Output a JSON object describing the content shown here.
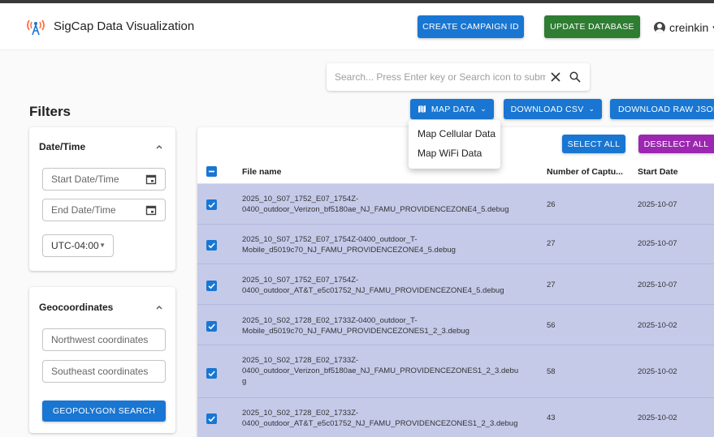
{
  "app": {
    "title": "SigCap Data Visualization",
    "user": "creinkin",
    "create_campaign_label": "CREATE CAMPAIGN ID",
    "update_database_label": "UPDATE DATABASE"
  },
  "search": {
    "placeholder": "Search... Press Enter key or Search icon to submit search"
  },
  "filters": {
    "title": "Filters",
    "datetime": {
      "title": "Date/Time",
      "start_placeholder": "Start Date/Time",
      "end_placeholder": "End Date/Time",
      "timezone": "UTC-04:00"
    },
    "geo": {
      "title": "Geocoordinates",
      "northwest_placeholder": "Northwest coordinates",
      "southeast_placeholder": "Southeast coordinates",
      "search_label": "GEOPOLYGON SEARCH"
    }
  },
  "toolbar": {
    "map_data_label": "MAP DATA",
    "download_csv_label": "DOWNLOAD CSV",
    "download_json_label": "DOWNLOAD RAW JSON",
    "select_all_label": "SELECT ALL",
    "deselect_all_label": "DESELECT ALL"
  },
  "map_menu": {
    "items": [
      "Map Cellular Data",
      "Map WiFi Data"
    ]
  },
  "table": {
    "headers": {
      "file_name": "File name",
      "captures": "Number of Captu...",
      "start_date": "Start Date"
    },
    "rows": [
      {
        "file": "2025_10_S07_1752_E07_1754Z-0400_outdoor_Verizon_bf5180ae_NJ_FAMU_PROVIDENCEZONE4_5.debug",
        "line1": "2025_10_S07_1752_E07_1754Z-",
        "line2": "0400_outdoor_Verizon_bf5180ae_NJ_FAMU_PROVIDENCEZONE4_5.debug",
        "line3": "",
        "count": "26",
        "date": "2025-10-07"
      },
      {
        "file": "2025_10_S07_1752_E07_1754Z-0400_outdoor_T-Mobile_d5019c70_NJ_FAMU_PROVIDENCEZONE4_5.debug",
        "line1": "2025_10_S07_1752_E07_1754Z-0400_outdoor_T-",
        "line2": "Mobile_d5019c70_NJ_FAMU_PROVIDENCEZONE4_5.debug",
        "line3": "",
        "count": "27",
        "date": "2025-10-07"
      },
      {
        "file": "2025_10_S07_1752_E07_1754Z-0400_outdoor_AT&T_e5c01752_NJ_FAMU_PROVIDENCEZONE4_5.debug",
        "line1": "2025_10_S07_1752_E07_1754Z-",
        "line2": "0400_outdoor_AT&T_e5c01752_NJ_FAMU_PROVIDENCEZONE4_5.debug",
        "line3": "",
        "count": "27",
        "date": "2025-10-07"
      },
      {
        "file": "2025_10_S02_1728_E02_1733Z-0400_outdoor_T-Mobile_d5019c70_NJ_FAMU_PROVIDENCEZONES1_2_3.debug",
        "line1": "2025_10_S02_1728_E02_1733Z-0400_outdoor_T-",
        "line2": "Mobile_d5019c70_NJ_FAMU_PROVIDENCEZONES1_2_3.debug",
        "line3": "",
        "count": "56",
        "date": "2025-10-02"
      },
      {
        "file": "2025_10_S02_1728_E02_1733Z-0400_outdoor_Verizon_bf5180ae_NJ_FAMU_PROVIDENCEZONES1_2_3.debug",
        "line1": "2025_10_S02_1728_E02_1733Z-",
        "line2": "0400_outdoor_Verizon_bf5180ae_NJ_FAMU_PROVIDENCEZONES1_2_3.debu",
        "line3": "g",
        "count": "58",
        "date": "2025-10-02"
      },
      {
        "file": "2025_10_S02_1728_E02_1733Z-0400_outdoor_AT&T_e5c01752_NJ_FAMU_PROVIDENCEZONES1_2_3.debug",
        "line1": "2025_10_S02_1728_E02_1733Z-",
        "line2": "0400_outdoor_AT&T_e5c01752_NJ_FAMU_PROVIDENCEZONES1_2_3.debug",
        "line3": "",
        "count": "43",
        "date": "2025-10-02"
      }
    ]
  },
  "colors": {
    "primary": "#1976d2",
    "success": "#2e7d32",
    "secondary": "#9c27b0",
    "row_selected": "#c5cae9"
  },
  "icons": {
    "logo": "antenna-signal-icon",
    "user": "account-circle-icon",
    "search": "search-icon",
    "clear": "close-icon",
    "calendar": "calendar-icon",
    "map": "map-icon",
    "chevron": "chevron-down-icon",
    "collapse": "chevron-up-icon",
    "checkbox": "checkbox-checked-icon",
    "indeterminate": "checkbox-indeterminate-icon"
  }
}
